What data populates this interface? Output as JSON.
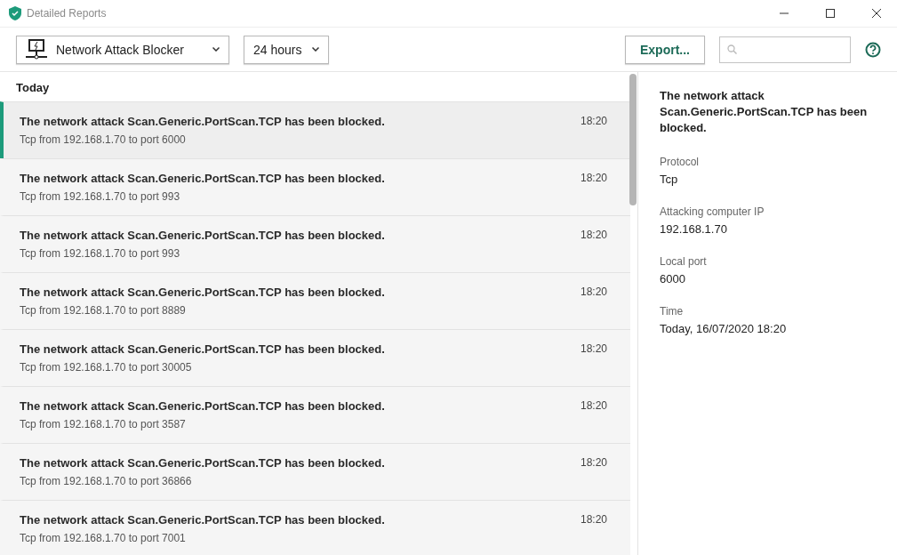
{
  "window": {
    "title": "Detailed Reports"
  },
  "toolbar": {
    "component": "Network Attack Blocker",
    "period": "24 hours",
    "export": "Export..."
  },
  "list": {
    "group": "Today",
    "events": [
      {
        "title": "The network attack Scan.Generic.PortScan.TCP has been blocked.",
        "details": "Tcp from 192.168.1.70 to port 6000",
        "time": "18:20",
        "selected": true
      },
      {
        "title": "The network attack Scan.Generic.PortScan.TCP has been blocked.",
        "details": "Tcp from 192.168.1.70 to port 993",
        "time": "18:20",
        "selected": false
      },
      {
        "title": "The network attack Scan.Generic.PortScan.TCP has been blocked.",
        "details": "Tcp from 192.168.1.70 to port 993",
        "time": "18:20",
        "selected": false
      },
      {
        "title": "The network attack Scan.Generic.PortScan.TCP has been blocked.",
        "details": "Tcp from 192.168.1.70 to port 8889",
        "time": "18:20",
        "selected": false
      },
      {
        "title": "The network attack Scan.Generic.PortScan.TCP has been blocked.",
        "details": "Tcp from 192.168.1.70 to port 30005",
        "time": "18:20",
        "selected": false
      },
      {
        "title": "The network attack Scan.Generic.PortScan.TCP has been blocked.",
        "details": "Tcp from 192.168.1.70 to port 3587",
        "time": "18:20",
        "selected": false
      },
      {
        "title": "The network attack Scan.Generic.PortScan.TCP has been blocked.",
        "details": "Tcp from 192.168.1.70 to port 36866",
        "time": "18:20",
        "selected": false
      },
      {
        "title": "The network attack Scan.Generic.PortScan.TCP has been blocked.",
        "details": "Tcp from 192.168.1.70 to port 7001",
        "time": "18:20",
        "selected": false
      }
    ]
  },
  "details": {
    "title": "The network attack Scan.Generic.PortScan.TCP has been blocked.",
    "fields": [
      {
        "label": "Protocol",
        "value": "Tcp"
      },
      {
        "label": "Attacking computer IP",
        "value": "192.168.1.70"
      },
      {
        "label": "Local port",
        "value": "6000"
      },
      {
        "label": "Time",
        "value": "Today, 16/07/2020 18:20"
      }
    ]
  }
}
